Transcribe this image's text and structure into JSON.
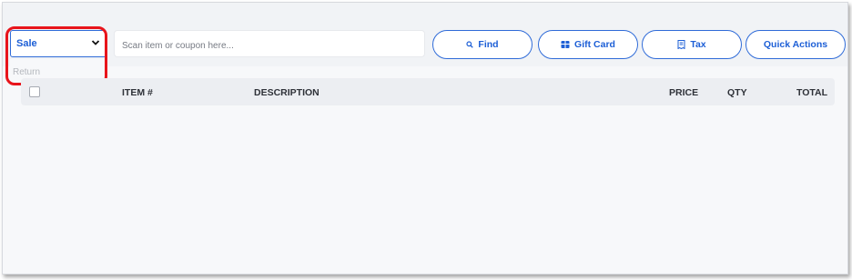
{
  "mode_select": {
    "selected": "Sale",
    "options_visible": [
      "Return"
    ]
  },
  "scan": {
    "placeholder": "Scan item or coupon here..."
  },
  "buttons": {
    "find": "Find",
    "gift_card": "Gift Card",
    "tax": "Tax",
    "quick_actions": "Quick Actions"
  },
  "table": {
    "columns": {
      "item": "ITEM #",
      "description": "DESCRIPTION",
      "price": "PRICE",
      "qty": "QTY",
      "total": "TOTAL"
    }
  },
  "colors": {
    "accent": "#1d5fd6",
    "highlight": "#e8141b"
  }
}
